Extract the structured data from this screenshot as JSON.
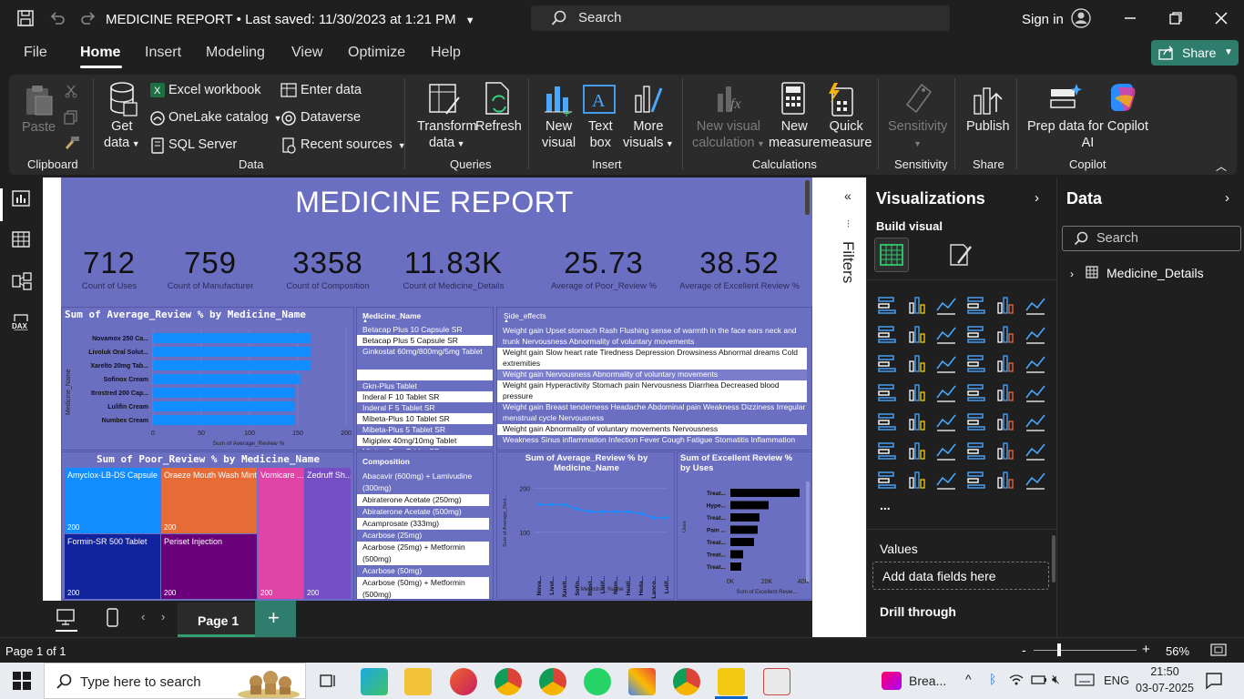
{
  "titlebar": {
    "title": "MEDICINE REPORT",
    "saved": "Last saved: 11/30/2023 at 1:21 PM",
    "search_placeholder": "Search",
    "signin": "Sign in"
  },
  "menu": {
    "items": [
      "File",
      "Home",
      "Insert",
      "Modeling",
      "View",
      "Optimize",
      "Help"
    ],
    "active": "Home",
    "share": "Share"
  },
  "ribbon": {
    "paste": "Paste",
    "get_data": [
      "Get",
      "data"
    ],
    "excel": "Excel workbook",
    "onelake": "OneLake catalog",
    "sql": "SQL Server",
    "enter_data": "Enter data",
    "dataverse": "Dataverse",
    "recent_sources": "Recent sources",
    "transform": [
      "Transform",
      "data"
    ],
    "refresh": "Refresh",
    "new_visual": [
      "New",
      "visual"
    ],
    "text_box": [
      "Text",
      "box"
    ],
    "more_visuals": [
      "More",
      "visuals"
    ],
    "new_visual_calc": [
      "New visual",
      "calculation"
    ],
    "new_measure": [
      "New",
      "measure"
    ],
    "quick_measure": [
      "Quick",
      "measure"
    ],
    "sensitivity": "Sensitivity",
    "publish": "Publish",
    "prep_data": [
      "Prep data for Copilot",
      "AI"
    ],
    "groups": [
      "Clipboard",
      "Data",
      "Queries",
      "Insert",
      "Calculations",
      "Sensitivity",
      "Share",
      "Copilot"
    ]
  },
  "report": {
    "title": "MEDICINE REPORT",
    "kpis": [
      {
        "value": "712",
        "label": "Count of Uses"
      },
      {
        "value": "759",
        "label": "Count of Manufacturer"
      },
      {
        "value": "3358",
        "label": "Count of Composition"
      },
      {
        "value": "11.83K",
        "label": "Count of Medicine_Details"
      },
      {
        "value": "25.73",
        "label": "Average of Poor_Review %"
      },
      {
        "value": "38.52",
        "label": "Average of Excellent Review %"
      }
    ],
    "bar_chart": {
      "title": "Sum of Average_Review % by Medicine_Name",
      "ylabel": "Medicine_Name",
      "xlabel": "Sum of Average_Review %",
      "ticks": [
        "0",
        "50",
        "100",
        "150",
        "200"
      ]
    },
    "med_table": {
      "header": "Medicine_Name",
      "rows": [
        "Betacap Plus 10 Capsule SR",
        "Betacap Plus 5 Capsule SR",
        "Ginkostat 60mg/800mg/5mg Tablet",
        "",
        "Gkn-Plus Tablet",
        "Inderal F 10 Tablet SR",
        "Inderal F 5 Tablet SR",
        "Mibeta-Plus 10 Tablet SR",
        "Mibeta-Plus 5 Tablet SR",
        "Migiplex 40mg/10mg Tablet",
        "Migitus 5mg Tablet SR"
      ]
    },
    "side_table": {
      "header": "Side_effects",
      "rows": [
        "Weight gain Upset stomach Rash Flushing sense of warmth in the face ears neck and trunk Nervousness Abnormality of voluntary movements",
        "Weight gain Slow heart rate Tiredness Depression Drowsiness Abnormal dreams Cold extremities",
        "Weight gain Nervousness Abnormality of voluntary movements",
        "Weight gain Hyperactivity Stomach pain Nervousness Diarrhea Decreased blood pressure",
        "Weight gain Breast tenderness Headache Abdominal pain Weakness Dizziness Irregular menstrual cycle Nervousness",
        "Weight gain Abnormality of voluntary movements Nervousness",
        "Weakness Sinus inflammation Infection Fever Cough Fatigue Stomatitis Inflammation"
      ]
    },
    "treemap": {
      "title": "Sum of Poor_Review % by Medicine_Name",
      "cells": [
        {
          "name": "Amyclox-LB-DS Capsule",
          "value": "200",
          "color": "#118dff"
        },
        {
          "name": "Oraeze Mouth Wash Mint",
          "value": "200",
          "color": "#e66c37"
        },
        {
          "name": "Vomicare ...",
          "value": "200",
          "color": "#e044a7"
        },
        {
          "name": "Zedruff Sh...",
          "value": "200",
          "color": "#744ec2"
        },
        {
          "name": "Formin-SR 500 Tablet",
          "value": "200",
          "color": "#12239e"
        },
        {
          "name": "Periset Injection",
          "value": "200",
          "color": "#6b007b"
        }
      ]
    },
    "comp_table": {
      "header": "Composition",
      "rows": [
        "Abacavir (600mg) + Lamivudine (300mg)",
        "Abiraterone Acetate (250mg)",
        "Abiraterone Acetate (500mg)",
        "Acamprosate (333mg)",
        "Acarbose (25mg)",
        "Acarbose (25mg) + Metformin (500mg)",
        "Acarbose (50mg)",
        "Acarbose (50mg) + Metformin (500mg)"
      ]
    },
    "line_chart": {
      "title": "Sum of Average_Review % by Medicine_Name",
      "ylabel": "Sum of Average_Revi...",
      "xlabel": "Medicine_Name",
      "yticks": [
        "200",
        "100"
      ]
    },
    "uses_chart": {
      "title": "Sum of Excellent Review % by Uses",
      "ylabel": "Uses",
      "xlabel": "Sum of Excellent Revie...",
      "ticks": [
        "0K",
        "20K",
        "40K"
      ]
    }
  },
  "chart_data": [
    {
      "type": "bar",
      "title": "Sum of Average_Review % by Medicine_Name",
      "categories": [
        "Novamox 250 Ca...",
        "Livoluk Oral Solut...",
        "Xarelto 20mg Tab...",
        "Sofinox Cream",
        "Itrostred 200 Cap...",
        "Lulifin Cream",
        "Numbex Cream"
      ],
      "values": [
        163,
        163,
        163,
        153,
        147,
        147,
        147
      ],
      "xlim": [
        0,
        200
      ]
    },
    {
      "type": "line",
      "title": "Sum of Average_Review % by Medicine_Name",
      "categories": [
        "Nova...",
        "Livol...",
        "Xarelt...",
        "Sofin...",
        "Itrost...",
        "Lulif...",
        "Num...",
        "Heidi...",
        "Heda...",
        "Lanco...",
        "Lulif..."
      ],
      "values": [
        163,
        163,
        163,
        153,
        147,
        147,
        147,
        147,
        143,
        133,
        133
      ],
      "ylim": [
        0,
        220
      ]
    },
    {
      "type": "bar",
      "title": "Sum of Excellent Review % by Uses",
      "categories": [
        "Treat...",
        "Hype...",
        "Treat...",
        "Pain ...",
        "Treat...",
        "Treat...",
        "Treat..."
      ],
      "values": [
        38000,
        21000,
        16000,
        15000,
        13000,
        7000,
        6000
      ],
      "xlim": [
        0,
        40000
      ]
    }
  ],
  "filters": {
    "label": "Filters"
  },
  "viz_pane": {
    "title": "Visualizations",
    "build_visual": "Build visual",
    "more": "...",
    "values": "Values",
    "add_fields": "Add data fields here",
    "drill_through": "Drill through"
  },
  "data_pane": {
    "title": "Data",
    "search_placeholder": "Search",
    "table_name": "Medicine_Details"
  },
  "pages": {
    "tab": "Page 1"
  },
  "status": {
    "page": "Page 1 of 1",
    "zoom": "56%"
  },
  "taskbar": {
    "search": "Type here to search",
    "weather": "Brea...",
    "lang": "ENG",
    "time": "21:50",
    "date": "03-07-2025"
  }
}
